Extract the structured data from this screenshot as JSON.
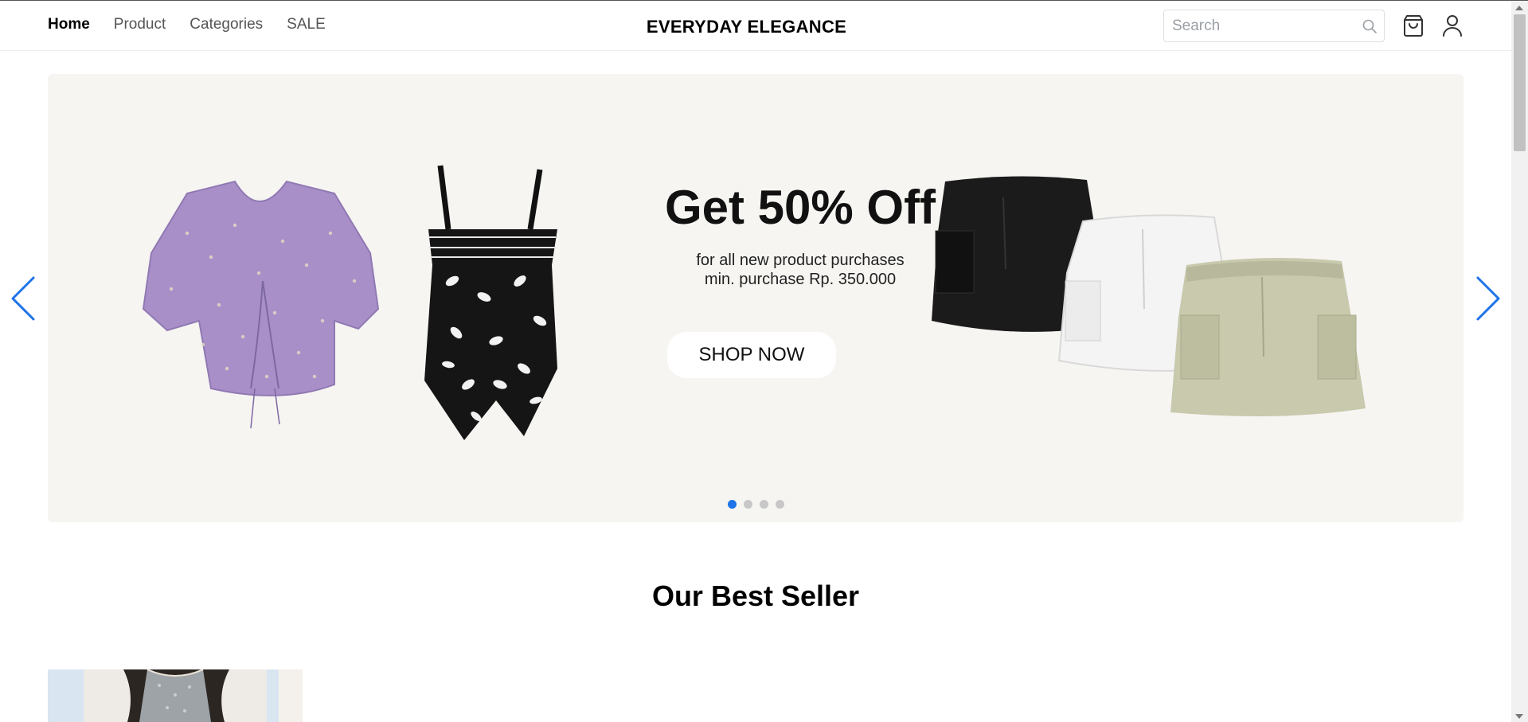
{
  "header": {
    "brand": "EVERYDAY ELEGANCE",
    "nav": [
      "Home",
      "Product",
      "Categories",
      "SALE"
    ],
    "active_nav": "Home",
    "search": {
      "placeholder": "Search",
      "value": ""
    },
    "icons": {
      "search": "search-icon",
      "cart": "shopping-bag-icon",
      "user": "user-icon"
    }
  },
  "hero": {
    "headline": "Get 50% Off",
    "subline1": "for all new product purchases",
    "subline2": "min. purchase Rp. 350.000",
    "cta": "SHOP NOW",
    "slide_count": 4,
    "active_slide": 1,
    "icons": {
      "prev": "chevron-left-icon",
      "next": "chevron-right-icon"
    }
  },
  "best_seller": {
    "title": "Our Best Seller"
  },
  "colors": {
    "accent": "#1e73e8",
    "hero_bg": "#f6f5f2",
    "dot_inactive": "#c8c8c8"
  }
}
